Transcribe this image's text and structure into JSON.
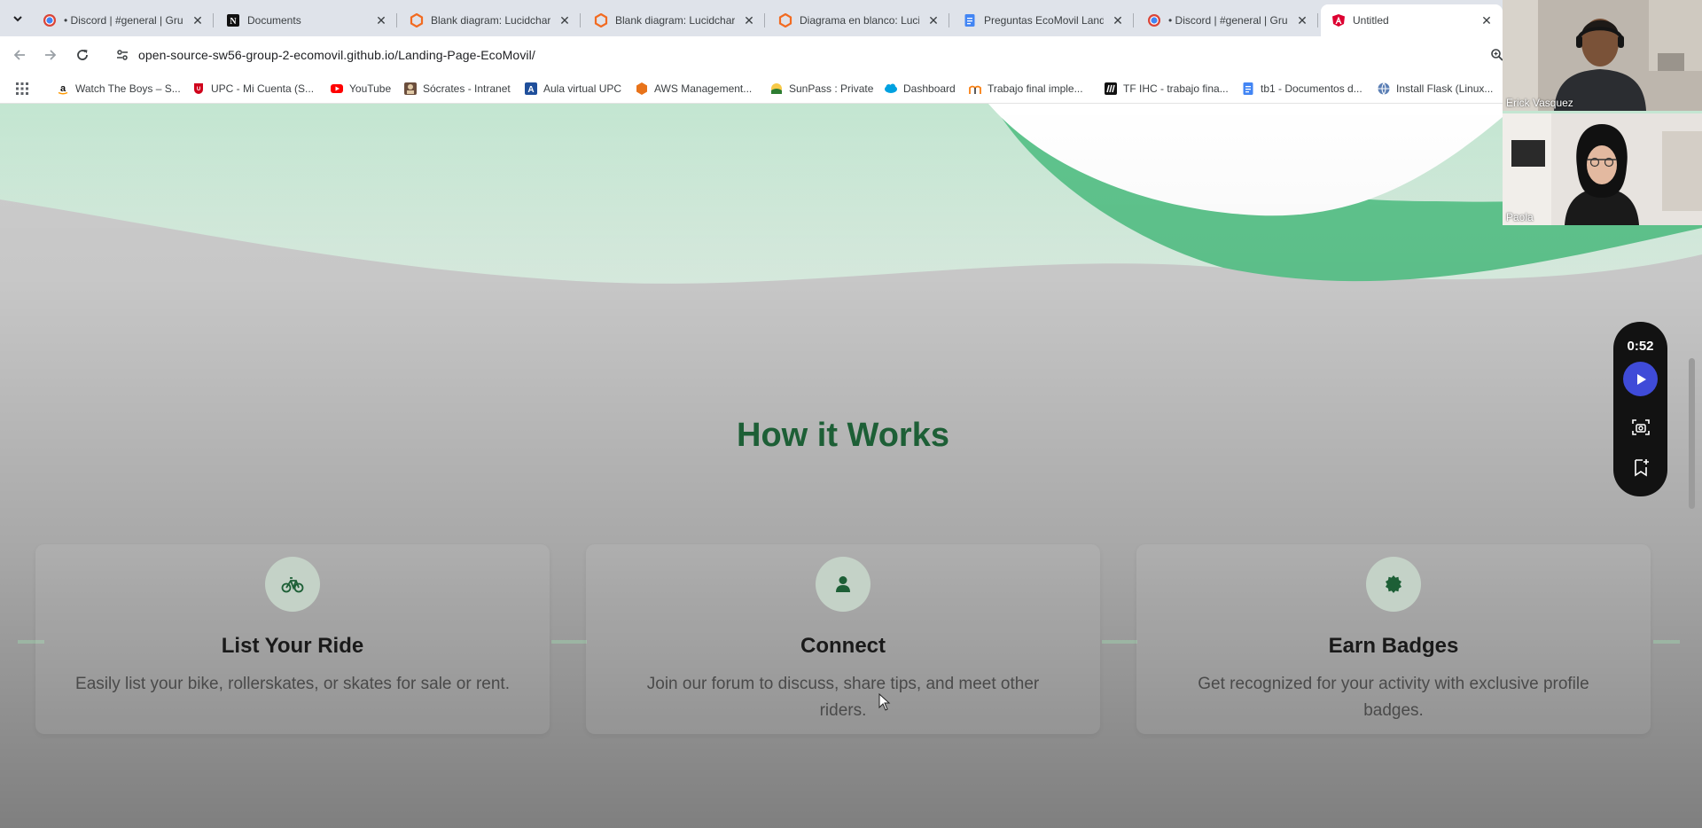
{
  "browser": {
    "tabs": [
      {
        "title": "• Discord | #general | Gru",
        "icon": "chrome-discord-icon",
        "active": false
      },
      {
        "title": "Documents",
        "icon": "notion-icon",
        "active": false
      },
      {
        "title": "Blank diagram: Lucidchart",
        "icon": "lucidchart-icon",
        "active": false
      },
      {
        "title": "Blank diagram: Lucidchart",
        "icon": "lucidchart-icon",
        "active": false
      },
      {
        "title": "Diagrama en blanco: Luci",
        "icon": "lucidchart-icon",
        "active": false
      },
      {
        "title": "Preguntas EcoMovil Land",
        "icon": "google-docs-icon",
        "active": false
      },
      {
        "title": "• Discord | #general | Gru",
        "icon": "chrome-discord-icon",
        "active": false
      },
      {
        "title": "Untitled",
        "icon": "angular-icon",
        "active": true
      }
    ],
    "tab_close_glyph": "✕",
    "url": "open-source-sw56-group-2-ecomovil.github.io/Landing-Page-EcoMovil/",
    "bookmarks": [
      {
        "label": "Watch The Boys – S...",
        "icon": "amazon-icon"
      },
      {
        "label": "UPC - Mi Cuenta (S...",
        "icon": "upc-icon"
      },
      {
        "label": "YouTube",
        "icon": "youtube-icon"
      },
      {
        "label": "Sócrates - Intranet",
        "icon": "socrates-icon"
      },
      {
        "label": "Aula virtual UPC",
        "icon": "aula-virtual-icon"
      },
      {
        "label": "AWS Management...",
        "icon": "aws-icon"
      },
      {
        "label": "SunPass : Private",
        "icon": "sunpass-icon"
      },
      {
        "label": "Dashboard",
        "icon": "salesforce-icon"
      },
      {
        "label": "Trabajo final imple...",
        "icon": "moodle-icon"
      },
      {
        "label": "TF IHC - trabajo fina...",
        "icon": "miro-icon"
      },
      {
        "label": "tb1 - Documentos d...",
        "icon": "google-docs-icon"
      },
      {
        "label": "Install Flask (Linux...",
        "icon": "globe-icon"
      }
    ]
  },
  "page": {
    "section_title": "How it Works",
    "steps": [
      {
        "title": "List Your Ride",
        "description": "Easily list your bike, rollerskates, or skates for sale or rent.",
        "icon": "bicycle-icon"
      },
      {
        "title": "Connect",
        "description": "Join our forum to discuss, share tips, and meet other riders.",
        "icon": "user-icon"
      },
      {
        "title": "Earn Badges",
        "description": "Get recognized for your activity with exclusive profile badges.",
        "icon": "badge-icon"
      }
    ],
    "colors": {
      "accent_green": "#5ec48e",
      "title_green": "#1d5f36",
      "hero_light": "#cfe9da"
    }
  },
  "video_call": {
    "participants": [
      {
        "name": "Erick Vasquez"
      },
      {
        "name": "Paola"
      }
    ]
  },
  "recorder": {
    "time": "0:52"
  }
}
